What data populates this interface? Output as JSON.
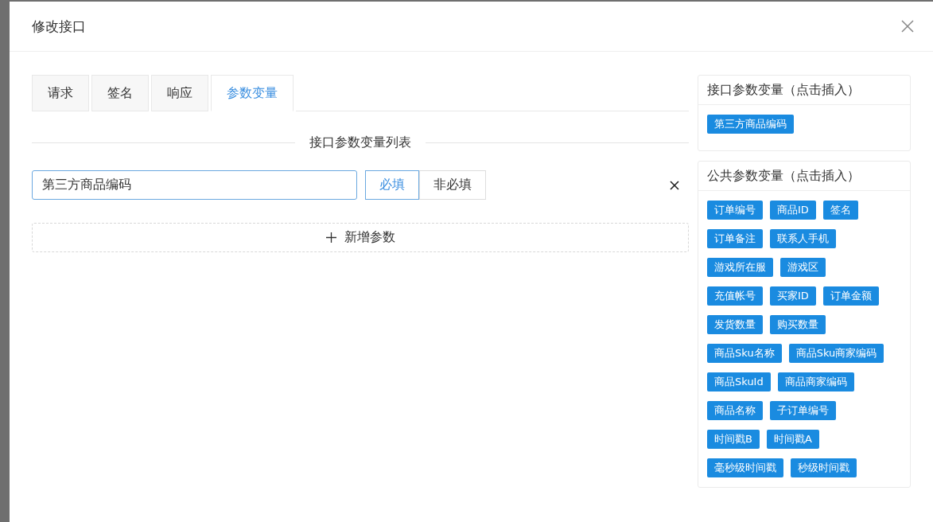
{
  "dialog": {
    "title": "修改接口"
  },
  "tabs": [
    {
      "label": "请求",
      "selected": false
    },
    {
      "label": "签名",
      "selected": false
    },
    {
      "label": "响应",
      "selected": false
    },
    {
      "label": "参数变量",
      "selected": true
    }
  ],
  "section_title": "接口参数变量列表",
  "params": [
    {
      "value": "第三方商品编码",
      "options": [
        {
          "label": "必填",
          "selected": true
        },
        {
          "label": "非必填",
          "selected": false
        }
      ]
    }
  ],
  "add_button": "新增参数",
  "panels": [
    {
      "title": "接口参数变量（点击插入）",
      "rows": [
        [
          "第三方商品编码"
        ]
      ]
    },
    {
      "title": "公共参数变量（点击插入）",
      "rows": [
        [
          "订单编号",
          "商品ID",
          "签名"
        ],
        [
          "订单备注",
          "联系人手机"
        ],
        [
          "游戏所在服",
          "游戏区"
        ],
        [
          "充值帐号",
          "买家ID",
          "订单金额"
        ],
        [
          "发货数量",
          "购买数量"
        ],
        [
          "商品Sku名称",
          "商品Sku商家编码"
        ],
        [
          "商品SkuId",
          "商品商家编码"
        ],
        [
          "商品名称",
          "子订单编号"
        ],
        [
          "时间戳B",
          "时间戳A"
        ],
        [
          "毫秒级时间戳",
          "秒级时间戳"
        ]
      ]
    }
  ]
}
